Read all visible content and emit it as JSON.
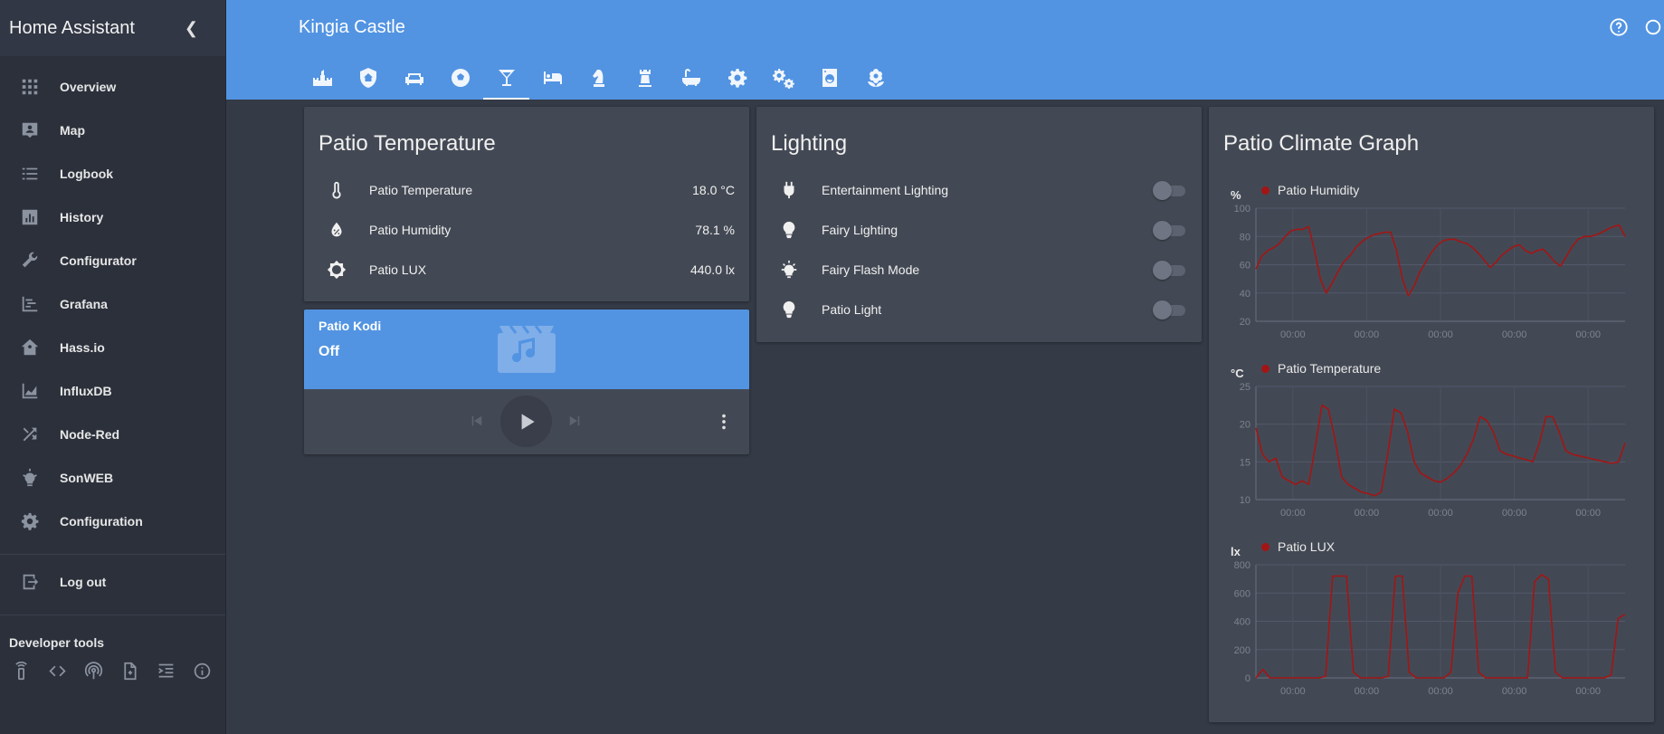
{
  "sidebar": {
    "brand": "Home Assistant",
    "items": [
      {
        "label": "Overview",
        "icon": "grid-icon"
      },
      {
        "label": "Map",
        "icon": "map-account-icon"
      },
      {
        "label": "Logbook",
        "icon": "list-icon"
      },
      {
        "label": "History",
        "icon": "chart-bar-icon"
      },
      {
        "label": "Configurator",
        "icon": "wrench-icon"
      },
      {
        "label": "Grafana",
        "icon": "chart-timeline-icon"
      },
      {
        "label": "Hass.io",
        "icon": "home-assistant-icon"
      },
      {
        "label": "InfluxDB",
        "icon": "chart-areaspline-icon"
      },
      {
        "label": "Node-Red",
        "icon": "shuffle-icon"
      },
      {
        "label": "SonWEB",
        "icon": "lightbulb-on-icon"
      },
      {
        "label": "Configuration",
        "icon": "gear-icon"
      }
    ],
    "logout": "Log out",
    "devtools_title": "Developer tools",
    "devtools": [
      "remote-icon",
      "code-icon",
      "radio-tower-icon",
      "file-icon",
      "format-indent-icon",
      "info-icon"
    ]
  },
  "header": {
    "title": "Kingia Castle",
    "tabs": [
      "castle-icon",
      "shield-home-icon",
      "sofa-icon",
      "soccer-icon",
      "glass-cocktail-icon",
      "bed-icon",
      "chess-knight-icon",
      "chess-rook-icon",
      "bathtub-icon",
      "gear-icon",
      "gears-icon",
      "washing-machine-icon",
      "flower-icon"
    ],
    "active_tab": 4
  },
  "patio_temp_card": {
    "title": "Patio Temperature",
    "rows": [
      {
        "name": "Patio Temperature",
        "value": "18.0 °C",
        "icon": "thermometer-icon"
      },
      {
        "name": "Patio Humidity",
        "value": "78.1 %",
        "icon": "water-percent-icon"
      },
      {
        "name": "Patio LUX",
        "value": "440.0 lx",
        "icon": "brightness-icon"
      }
    ]
  },
  "kodi": {
    "title": "Patio Kodi",
    "state": "Off"
  },
  "lighting": {
    "title": "Lighting",
    "rows": [
      {
        "name": "Entertainment Lighting",
        "icon": "power-plug-icon",
        "on": false
      },
      {
        "name": "Fairy Lighting",
        "icon": "lightbulb-icon",
        "on": false
      },
      {
        "name": "Fairy Flash Mode",
        "icon": "lightbulb-on-outline-icon",
        "on": false
      },
      {
        "name": "Patio Light",
        "icon": "lightbulb-icon",
        "on": false
      }
    ]
  },
  "graph": {
    "title": "Patio Climate Graph"
  },
  "colors": {
    "accent": "#5294e2",
    "series": "#a31515",
    "card": "#434954",
    "bg": "#343a46",
    "sidebar": "#2b303b"
  },
  "chart_data": [
    {
      "type": "line",
      "unit": "%",
      "series": [
        {
          "name": "Patio Humidity",
          "values": [
            57,
            66,
            70,
            72,
            75,
            80,
            84,
            85,
            85,
            87,
            70,
            50,
            40,
            47,
            55,
            62,
            66,
            72,
            76,
            79,
            81,
            82,
            83,
            83,
            70,
            50,
            38,
            45,
            55,
            62,
            69,
            74,
            77,
            78,
            78,
            76,
            75,
            72,
            68,
            63,
            58,
            62,
            67,
            70,
            73,
            74,
            70,
            68,
            70,
            71,
            67,
            62,
            59,
            66,
            73,
            78,
            80,
            80,
            81,
            83,
            85,
            87,
            88,
            80
          ]
        }
      ],
      "ylim": [
        20,
        100
      ],
      "yticks": [
        20,
        40,
        60,
        80,
        100
      ],
      "xticks": [
        "00:00",
        "00:00",
        "00:00",
        "00:00",
        "00:00"
      ]
    },
    {
      "type": "line",
      "unit": "°C",
      "series": [
        {
          "name": "Patio Temperature",
          "values": [
            19.5,
            16,
            15,
            15.5,
            13,
            12.5,
            12,
            12.5,
            12,
            17,
            22.5,
            22,
            18,
            13,
            12,
            11.5,
            11,
            10.8,
            10.5,
            11,
            16,
            22,
            21.5,
            19,
            15,
            13.5,
            13,
            12.5,
            12.3,
            12.8,
            13.5,
            14.5,
            16,
            18,
            21,
            20.5,
            19,
            16.5,
            16,
            15.8,
            15.5,
            15.3,
            15,
            17.5,
            21,
            21,
            19,
            16.5,
            16,
            15.8,
            15.6,
            15.4,
            15.2,
            15,
            14.8,
            15,
            17.5
          ]
        }
      ],
      "ylim": [
        10,
        25
      ],
      "yticks": [
        10,
        15,
        20,
        25
      ],
      "xticks": [
        "00:00",
        "00:00",
        "00:00",
        "00:00",
        "00:00"
      ]
    },
    {
      "type": "line",
      "unit": "lx",
      "series": [
        {
          "name": "Patio LUX",
          "values": [
            0,
            60,
            0,
            0,
            0,
            0,
            0,
            0,
            0,
            0,
            10,
            720,
            720,
            720,
            40,
            0,
            0,
            0,
            0,
            10,
            720,
            720,
            40,
            0,
            0,
            0,
            0,
            0,
            40,
            600,
            720,
            720,
            40,
            0,
            0,
            0,
            0,
            0,
            0,
            0,
            680,
            730,
            700,
            40,
            0,
            0,
            0,
            0,
            0,
            0,
            0,
            20,
            420,
            450
          ]
        }
      ],
      "ylim": [
        0,
        800
      ],
      "yticks": [
        0,
        200,
        400,
        600,
        800
      ],
      "xticks": [
        "00:00",
        "00:00",
        "00:00",
        "00:00",
        "00:00"
      ]
    }
  ]
}
